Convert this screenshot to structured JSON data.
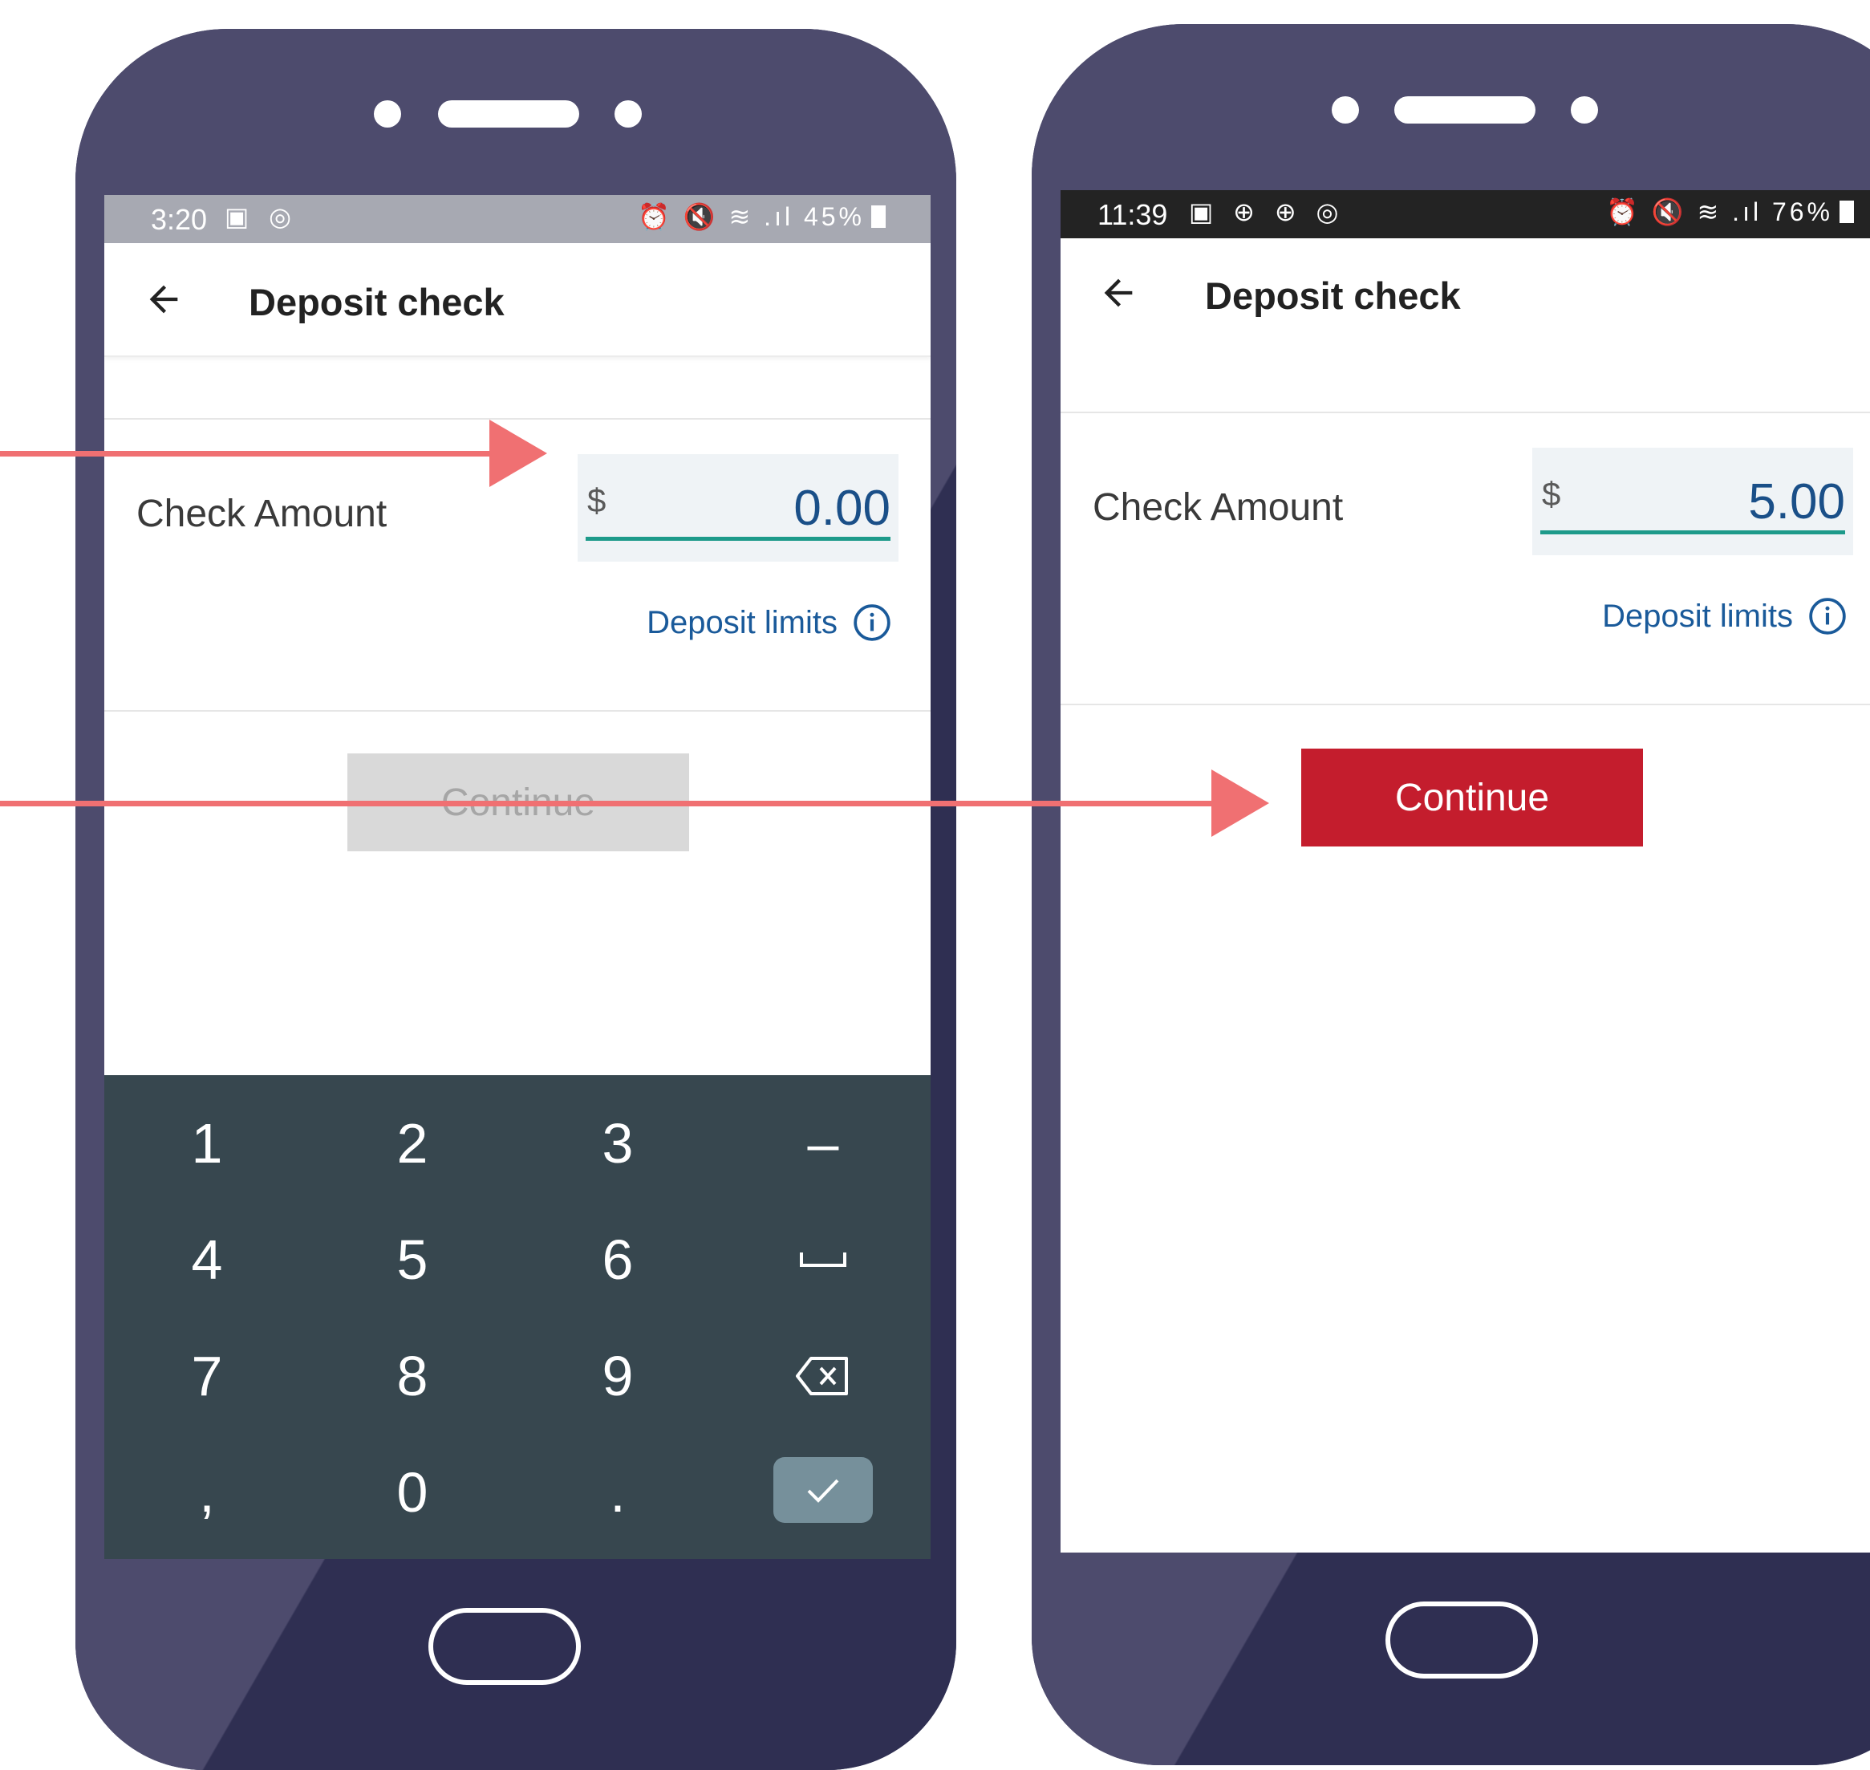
{
  "colors": {
    "phone_body": "#2f2f52",
    "arrow": "#f07072",
    "continue_enabled": "#c41d2d",
    "continue_disabled": "#d9d9d9",
    "keyboard": "#37474f",
    "link": "#1a5a9a",
    "underline": "#1d9a8a"
  },
  "left_phone": {
    "status": {
      "time": "3:20",
      "left_icons": "▣ ◎",
      "right_icons": "⏰ 🔇 ≋ .ıl",
      "battery": "45%"
    },
    "header": {
      "back_icon": "arrow-left-icon",
      "title": "Deposit check"
    },
    "form": {
      "label": "Check Amount",
      "currency": "$",
      "amount": "0.00",
      "limits_link": "Deposit limits",
      "limits_icon": "info-icon"
    },
    "continue_label": "Continue",
    "keyboard": {
      "keys": [
        "1",
        "2",
        "3",
        "–",
        "4",
        "5",
        "6",
        "␣",
        "7",
        "8",
        "9",
        "⌫",
        ",",
        "0",
        "."
      ],
      "done_icon": "check-icon"
    }
  },
  "right_phone": {
    "status": {
      "time": "11:39",
      "left_icons": "▣ ⊕ ⊕ ◎",
      "right_icons": "⏰ 🔇 ≋ .ıl",
      "battery": "76%"
    },
    "header": {
      "back_icon": "arrow-left-icon",
      "title": "Deposit check"
    },
    "form": {
      "label": "Check Amount",
      "currency": "$",
      "amount": "5.00",
      "limits_link": "Deposit limits",
      "limits_icon": "info-icon"
    },
    "continue_label": "Continue"
  }
}
